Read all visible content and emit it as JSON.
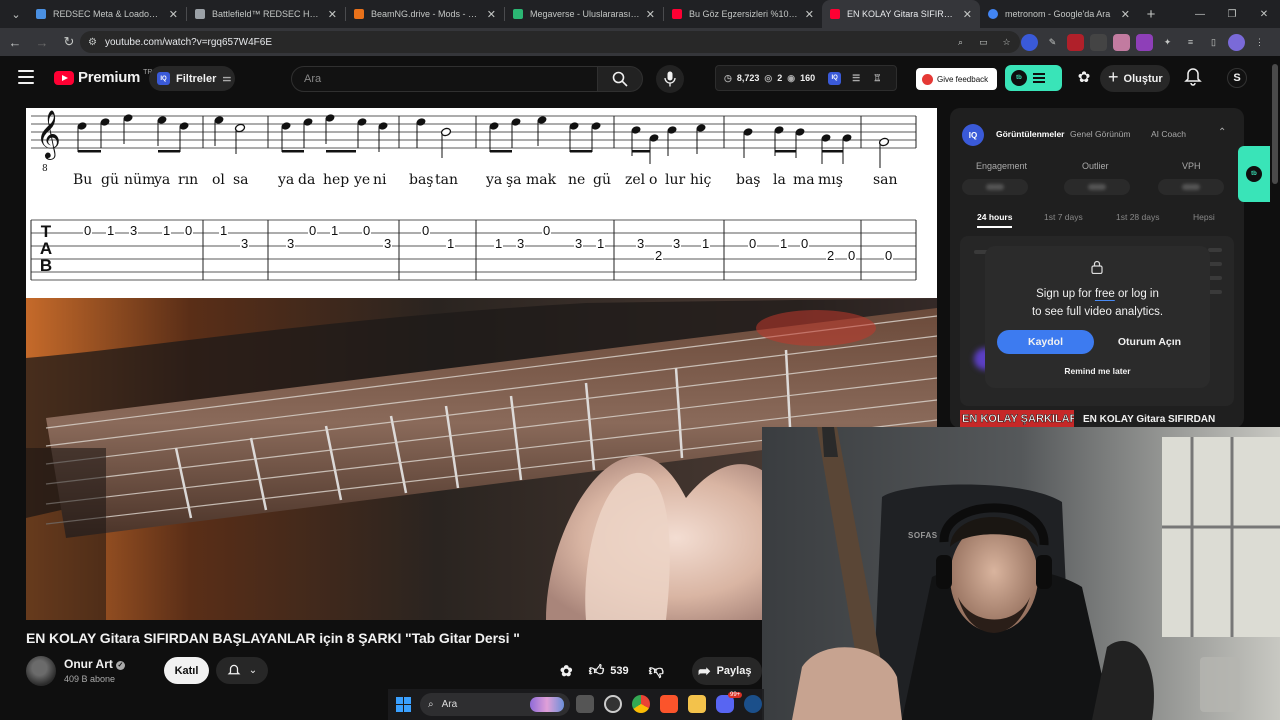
{
  "browser": {
    "tabs": [
      {
        "title": "REDSEC Meta & Loadouts - Bat",
        "favicon_color": "#4a90e2"
      },
      {
        "title": "Battlefield™ REDSEC Home - El",
        "favicon_color": "#9aa0a6"
      },
      {
        "title": "BeamNG.drive - Mods - Mods I",
        "favicon_color": "#e8711a"
      },
      {
        "title": "Megaverse - Uluslararası Sağlık",
        "favicon_color": "#2bb673"
      },
      {
        "title": "Bu Göz Egzersizleri %100 Görm",
        "favicon_color": "#ff0033"
      },
      {
        "title": "EN KOLAY Gitara SIFIRDAN BA",
        "favicon_color": "#ff0033",
        "active": true
      },
      {
        "title": "metronom - Google'da Ara",
        "favicon_color": "#4285f4"
      }
    ],
    "new_tab": "+",
    "url": "youtube.com/watch?v=rgq657W4F6E"
  },
  "youtube": {
    "logo_text": "Premium",
    "logo_badge": "TR",
    "filters_label": "Filtreler",
    "iq_badge": "IQ",
    "search_placeholder": "Ara",
    "stats": {
      "views": "8,723",
      "eyes": "2",
      "watching": "160"
    },
    "feedback_label": "Give feedback",
    "tb_badge": "tb",
    "create_label": "Oluştur",
    "avatar_letter": "S"
  },
  "video": {
    "title": "EN KOLAY Gitara SIFIRDAN BAŞLAYANLAR için 8 ŞARKI \"Tab Gitar Dersi \"",
    "channel": "Onur Art",
    "subscribers": "409 B abone",
    "join_label": "Katıl",
    "likes": "539",
    "share_label": "Paylaş",
    "sheet": {
      "clef_number": "8",
      "tab_letters": [
        "T",
        "A",
        "B"
      ],
      "lyrics": [
        "Bu",
        "gü",
        "nüm",
        "ya",
        "rın",
        "ol",
        "sa",
        "ya",
        "da",
        "hep",
        "ye",
        "ni",
        "baş",
        "tan",
        "ya",
        "şa",
        "mak",
        "ne",
        "gü",
        "zel",
        "o",
        "lur",
        "hiç",
        "baş",
        "la",
        "ma",
        "mış",
        "san"
      ],
      "tab_numbers": [
        "0",
        "1",
        "3",
        "1",
        "0",
        "1",
        "3",
        "3",
        "0",
        "1",
        "0",
        "3",
        "0",
        "1",
        "1",
        "3",
        "0",
        "3",
        "1",
        "3",
        "2",
        "3",
        "1",
        "0",
        "1",
        "0",
        "2",
        "0",
        "0"
      ]
    }
  },
  "analytics_panel": {
    "iq_badge": "IQ",
    "tabs": [
      "Görüntülenmeler",
      "Genel Görünüm",
      "AI Coach"
    ],
    "metrics": [
      "Engagement",
      "Outlier",
      "VPH"
    ],
    "ranges": [
      "24 hours",
      "1st 7 days",
      "1st 28 days",
      "Hepsi"
    ],
    "gate_line1_a": "Sign up for ",
    "gate_line1_free": "free",
    "gate_line1_b": " or log in",
    "gate_line2": "to see full video analytics.",
    "signup_label": "Kaydol",
    "login_label": "Oturum Açın",
    "remind_label": "Remind me later",
    "side_badge": "tb"
  },
  "recommendation": {
    "thumb_text": "EN KOLAY ŞARKILAR!",
    "title": "EN KOLAY Gitara SIFIRDAN"
  },
  "webcam": {
    "chair_text": "SOFAS"
  },
  "taskbar": {
    "search_placeholder": "Ara",
    "badge": "99+"
  },
  "colors": {
    "accent_red": "#ff0033",
    "tubebuddy_green": "#39e4b8",
    "iq_blue": "#3a5ad8",
    "signup_blue": "#3d7bf0"
  }
}
